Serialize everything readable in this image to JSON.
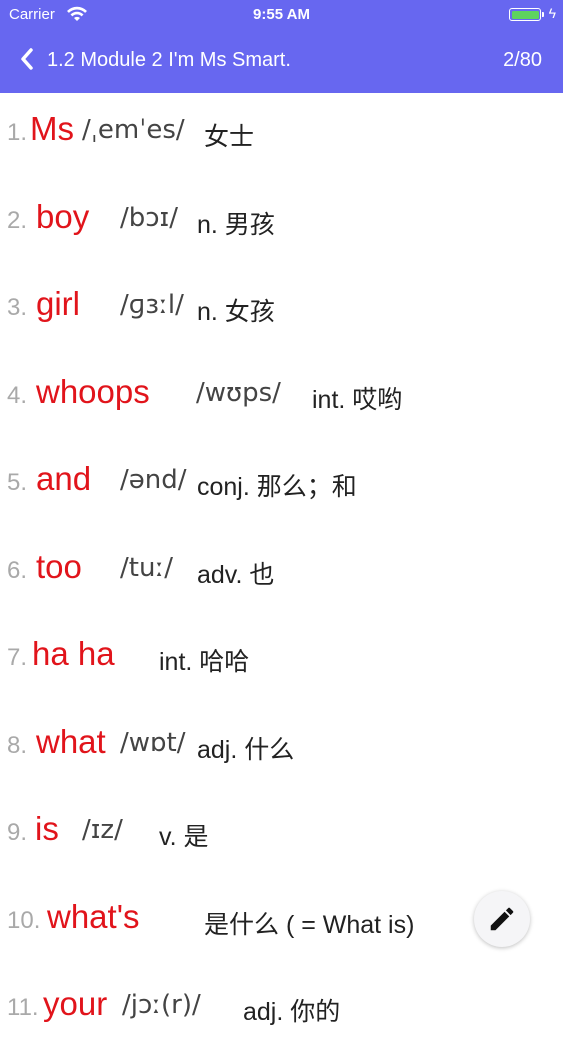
{
  "status_bar": {
    "carrier": "Carrier",
    "time": "9:55 AM",
    "wifi_icon": "wifi-icon",
    "battery_icon": "battery-icon",
    "battery_level": 1.0,
    "battery_color": "#5ed35e"
  },
  "nav": {
    "back_icon": "chevron-left-icon",
    "title": "1.2 Module 2 I'm Ms Smart.",
    "counter": "2/80",
    "bar_color": "#6767f0"
  },
  "words": [
    {
      "number": "1.",
      "word": "Ms",
      "ipa": "/ˌemˈes/",
      "meaning": "女士"
    },
    {
      "number": "2.",
      "word": "boy",
      "ipa": "/bɔɪ/",
      "meaning": "n. 男孩"
    },
    {
      "number": "3.",
      "word": "girl",
      "ipa": "/ɡɜːl/",
      "meaning": "n. 女孩"
    },
    {
      "number": "4.",
      "word": "whoops",
      "ipa": "/wʊps/",
      "meaning": "int. 哎哟"
    },
    {
      "number": "5.",
      "word": "and",
      "ipa": "/ənd/",
      "meaning": "conj. 那么；和"
    },
    {
      "number": "6.",
      "word": "too",
      "ipa": "/tuː/",
      "meaning": "adv. 也"
    },
    {
      "number": "7.",
      "word": "ha ha",
      "ipa": "",
      "meaning": "int. 哈哈"
    },
    {
      "number": "8.",
      "word": "what",
      "ipa": "/wɒt/",
      "meaning": "adj. 什么"
    },
    {
      "number": "9.",
      "word": "is",
      "ipa": "/ɪz/",
      "meaning": "v. 是"
    },
    {
      "number": "10.",
      "word": "what's",
      "ipa": "",
      "meaning": "是什么 ( = What is)"
    },
    {
      "number": "11.",
      "word": "your",
      "ipa": "/jɔː(r)/",
      "meaning": "adj. 你的"
    }
  ],
  "fab": {
    "icon": "pencil-icon"
  },
  "colors": {
    "word": "#e1141b",
    "number": "#a9a9a9"
  }
}
